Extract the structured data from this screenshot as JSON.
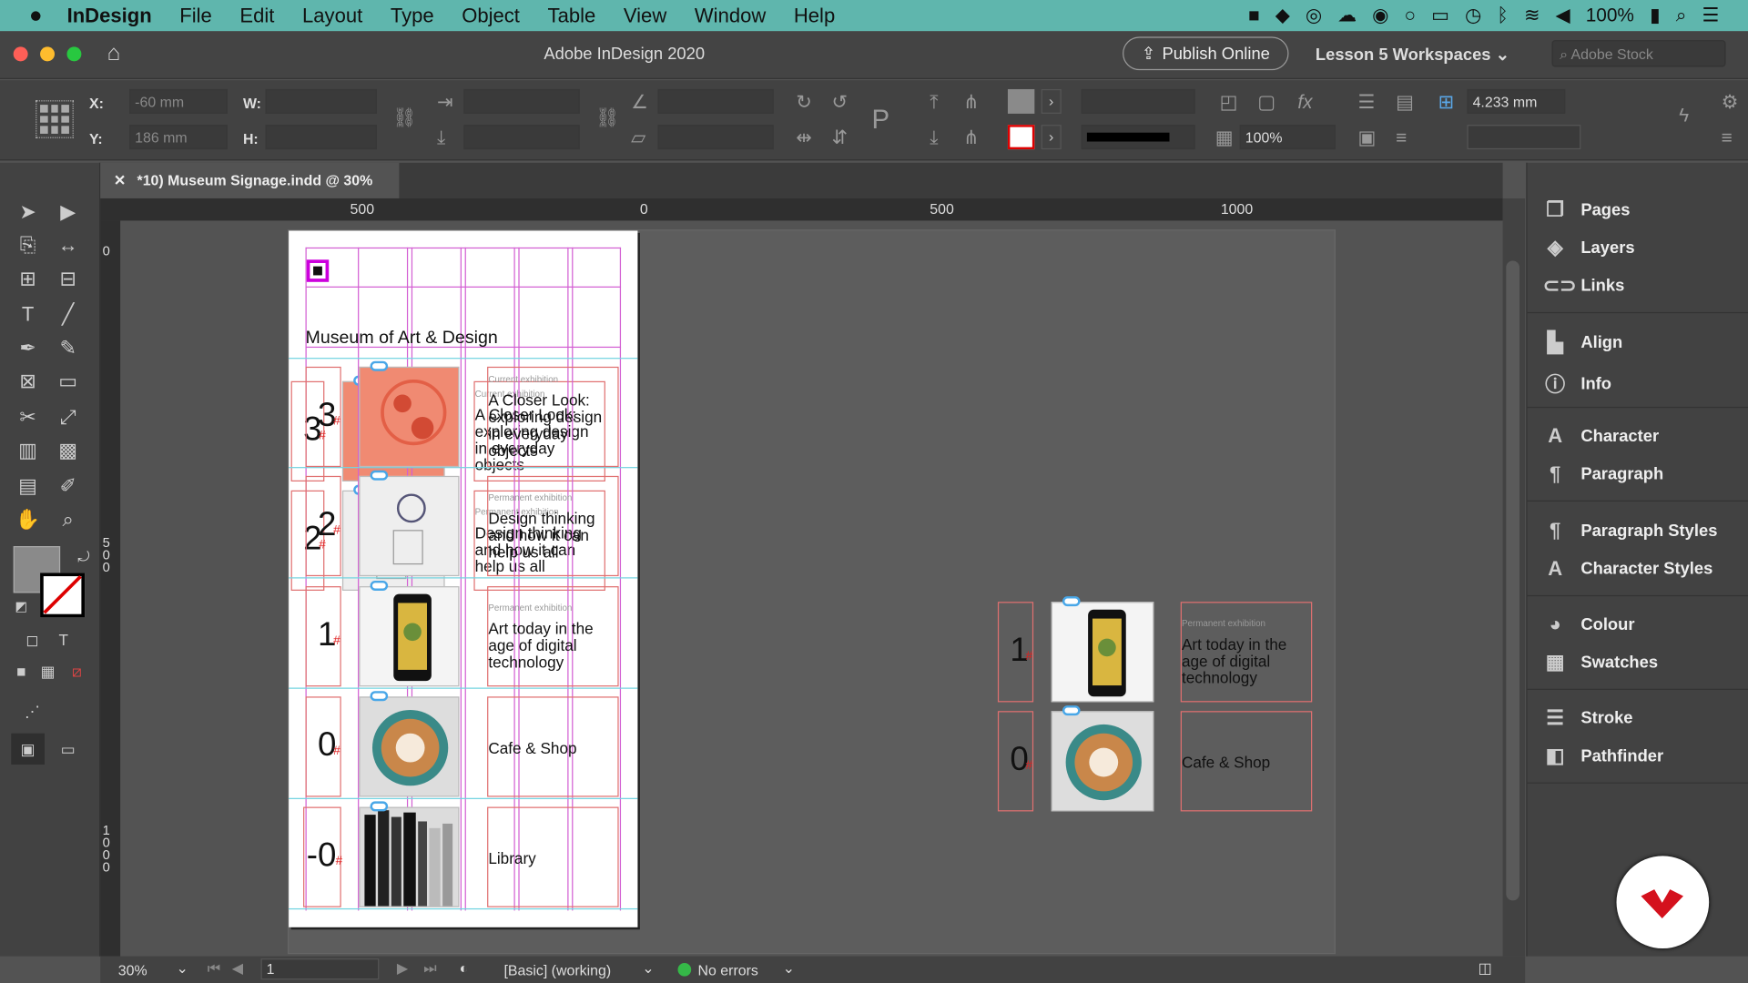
{
  "menubar": {
    "app": "InDesign",
    "items": [
      "File",
      "Edit",
      "Layout",
      "Type",
      "Object",
      "Table",
      "View",
      "Window",
      "Help"
    ],
    "battery": "100%"
  },
  "titlebar": {
    "title": "Adobe InDesign 2020",
    "publish": "Publish Online",
    "workspace": "Lesson 5 Workspaces",
    "stock_placeholder": "Adobe Stock"
  },
  "control": {
    "x_label": "X:",
    "x_value": "-60 mm",
    "y_label": "Y:",
    "y_value": "186 mm",
    "w_label": "W:",
    "h_label": "H:",
    "zoom_value": "100%",
    "stroke_weight": "4.233 mm"
  },
  "document": {
    "tab": "*10) Museum Signage.indd @ 30%"
  },
  "ruler": {
    "h_marks": [
      "500",
      "0",
      "500",
      "1000"
    ],
    "v_marks": [
      "0",
      "500",
      "1000"
    ]
  },
  "page": {
    "heading": "Museum of Art & Design",
    "rows": [
      {
        "num": "3",
        "label": "Current exhibition",
        "title": "A Closer Look: exploring design in everyday objects"
      },
      {
        "num": "2",
        "label": "Permanent exhibition",
        "title": "Design thinking and how it can help us all"
      },
      {
        "num": "1",
        "label": "Permanent exhibition",
        "title": "Art today in the age of digital technology"
      },
      {
        "num": "0",
        "label": "",
        "title": "Cafe & Shop"
      },
      {
        "num": "-0",
        "label": "",
        "title": "Library"
      }
    ]
  },
  "panels": {
    "items": [
      "Pages",
      "Layers",
      "Links",
      "Align",
      "Info",
      "Character",
      "Paragraph",
      "Paragraph Styles",
      "Character Styles",
      "Colour",
      "Swatches",
      "Stroke",
      "Pathfinder"
    ]
  },
  "status": {
    "zoom": "30%",
    "page": "1",
    "style": "[Basic] (working)",
    "errors": "No errors"
  },
  "colors": {
    "menubar": "#5fb6ad",
    "guide": "#d35fd3",
    "frame": "#e07070"
  }
}
